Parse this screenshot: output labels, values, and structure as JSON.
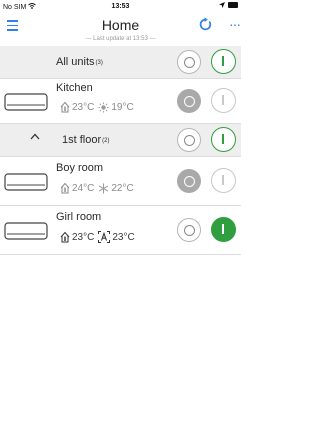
{
  "status_bar": {
    "carrier": "No SIM",
    "time": "13:53"
  },
  "header": {
    "title": "Home"
  },
  "last_update": "--- Last update at 13:53 ---",
  "all_units": {
    "label": "All units",
    "count": "(3)"
  },
  "floor": {
    "label": "1st floor",
    "count": "(2)"
  },
  "rooms": [
    {
      "name": "Kitchen",
      "indoor_temp": "23°C",
      "set_temp": "19°C",
      "mode_icon": "sun-icon"
    },
    {
      "name": "Boy room",
      "indoor_temp": "24°C",
      "set_temp": "22°C",
      "mode_icon": "snowflake-icon"
    },
    {
      "name": "Girl room",
      "indoor_temp": "23°C",
      "set_temp": "23°C",
      "mode_icon": "auto-mode-icon"
    }
  ],
  "colors": {
    "accent": "#2f80ed",
    "on_green": "#2f9e3e",
    "off_grey": "#a9a9a9",
    "group_bg": "#eeeeee"
  }
}
